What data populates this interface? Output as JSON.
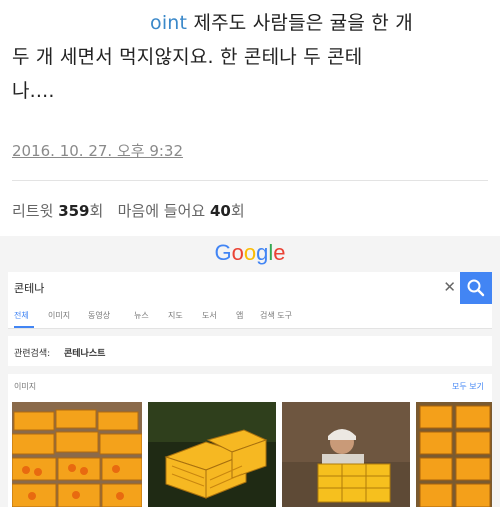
{
  "tweet": {
    "mention": "oint",
    "line1": " 제주도 사람들은 귤을 한 개",
    "line2": "두 개 세면서 먹지않지요. 한 콘테나 두 콘테",
    "line3": "나....",
    "date": "2016. 10. 27. 오후 9:32"
  },
  "stats": {
    "retweet_label": "리트윗",
    "retweet_count": "359",
    "retweet_unit": "회",
    "like_label": "마음에 들어요",
    "like_count": "40",
    "like_unit": "회"
  },
  "google": {
    "logo_letters": [
      "G",
      "o",
      "o",
      "g",
      "l",
      "e"
    ],
    "query": "콘테나",
    "tabs": [
      "전체",
      "이미지",
      "동영상",
      "뉴스",
      "지도",
      "도서",
      "앱",
      "검색 도구"
    ],
    "related_label": "관련검색:",
    "related_link": "콘테나스트",
    "images_title": "이미지",
    "images_more": "모두 보기"
  },
  "colors": {
    "link_blue": "#4285f4",
    "mention_blue": "#3a88c9",
    "crate_orange": "#f4a21b"
  }
}
